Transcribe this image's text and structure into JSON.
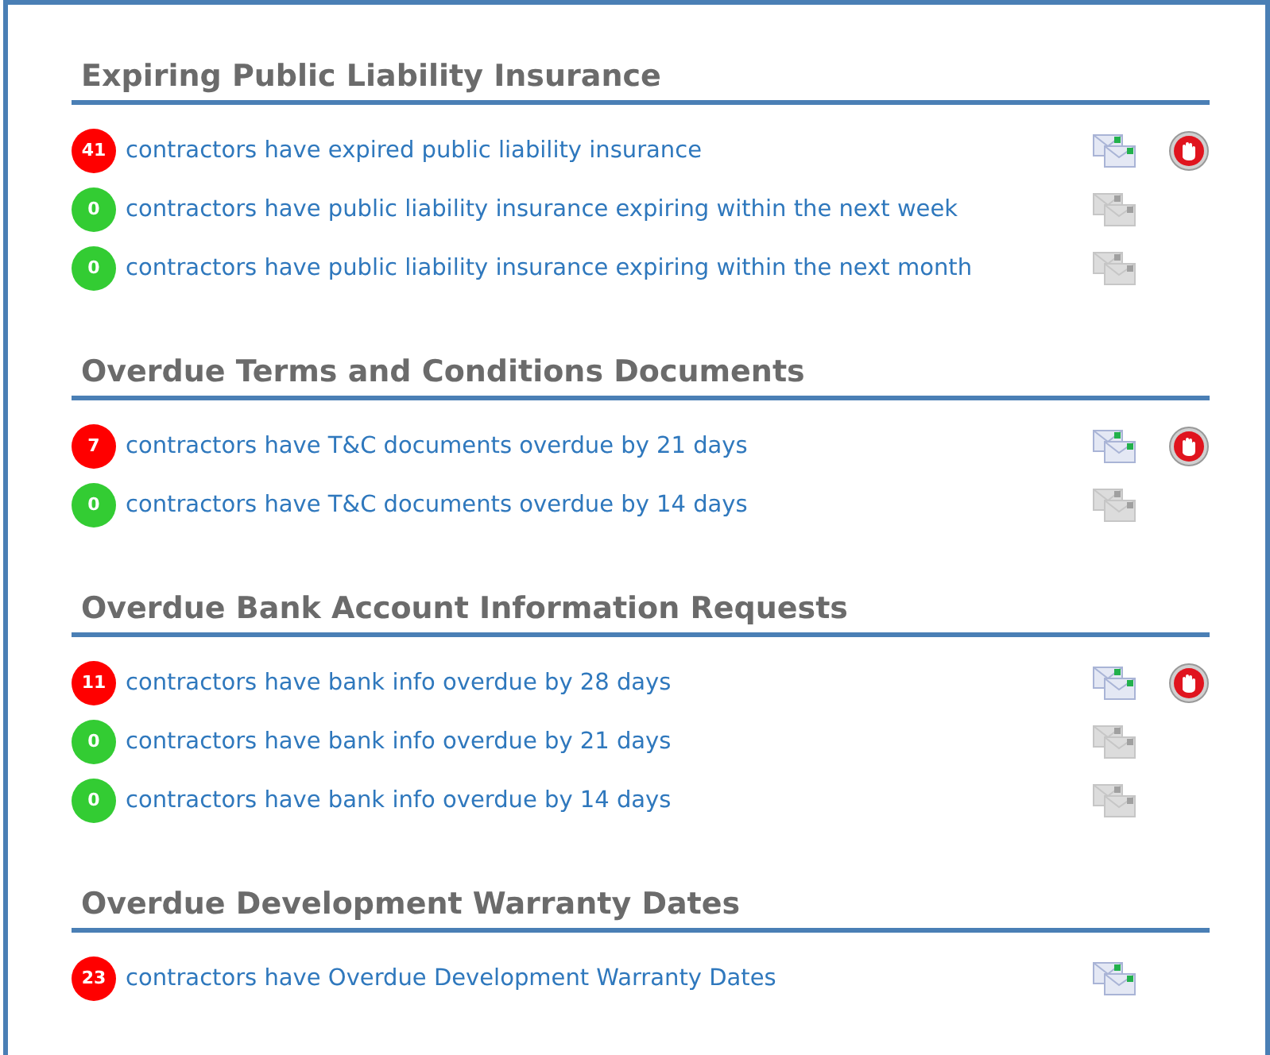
{
  "sections": [
    {
      "title": "Expiring Public Liability Insurance",
      "items": [
        {
          "count": "41",
          "color": "#ff0000",
          "text": "contractors have expired public liability insurance",
          "mail_enabled": true,
          "alert": true
        },
        {
          "count": "0",
          "color": "#33cc33",
          "text": "contractors have public liability insurance expiring within the next week",
          "mail_enabled": false,
          "alert": false
        },
        {
          "count": "0",
          "color": "#33cc33",
          "text": "contractors have public liability insurance expiring within the next month",
          "mail_enabled": false,
          "alert": false
        }
      ]
    },
    {
      "title": "Overdue Terms and Conditions Documents",
      "items": [
        {
          "count": "7",
          "color": "#ff0000",
          "text": "contractors have T&C documents overdue by 21 days",
          "mail_enabled": true,
          "alert": true
        },
        {
          "count": "0",
          "color": "#33cc33",
          "text": "contractors have T&C documents overdue by 14 days",
          "mail_enabled": false,
          "alert": false
        }
      ]
    },
    {
      "title": "Overdue Bank Account Information Requests",
      "items": [
        {
          "count": "11",
          "color": "#ff0000",
          "text": "contractors have bank info overdue by 28 days",
          "mail_enabled": true,
          "alert": true
        },
        {
          "count": "0",
          "color": "#33cc33",
          "text": "contractors have bank info overdue by 21 days",
          "mail_enabled": false,
          "alert": false
        },
        {
          "count": "0",
          "color": "#33cc33",
          "text": "contractors have bank info overdue by 14 days",
          "mail_enabled": false,
          "alert": false
        }
      ]
    },
    {
      "title": "Overdue Development Warranty Dates",
      "items": [
        {
          "count": "23",
          "color": "#ff0000",
          "text": "contractors have Overdue Development Warranty Dates",
          "mail_enabled": true,
          "alert": false
        }
      ]
    }
  ]
}
